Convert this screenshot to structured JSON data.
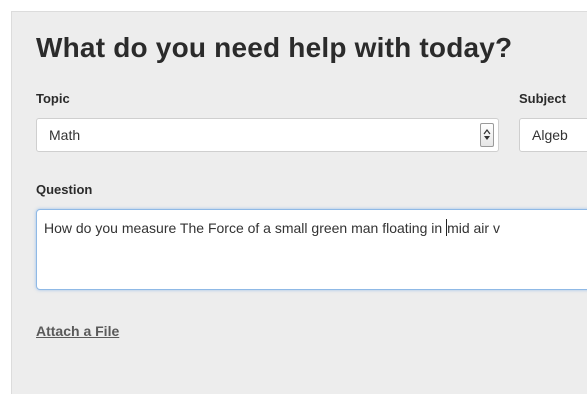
{
  "form": {
    "title": "What do you need help with today?",
    "topic": {
      "label": "Topic",
      "selected": "Math"
    },
    "subject": {
      "label": "Subject",
      "selected": "Algeb"
    },
    "question": {
      "label": "Question",
      "value_before_caret": "How do you measure The Force of a small green man floating in ",
      "value_after_caret": "mid air v"
    },
    "attach_label": "Attach a File"
  },
  "icons": {
    "topic_dropdown": "dropdown-arrow-icon"
  },
  "colors": {
    "panel_background": "#ededed",
    "focus_border": "#8fb9e6"
  }
}
